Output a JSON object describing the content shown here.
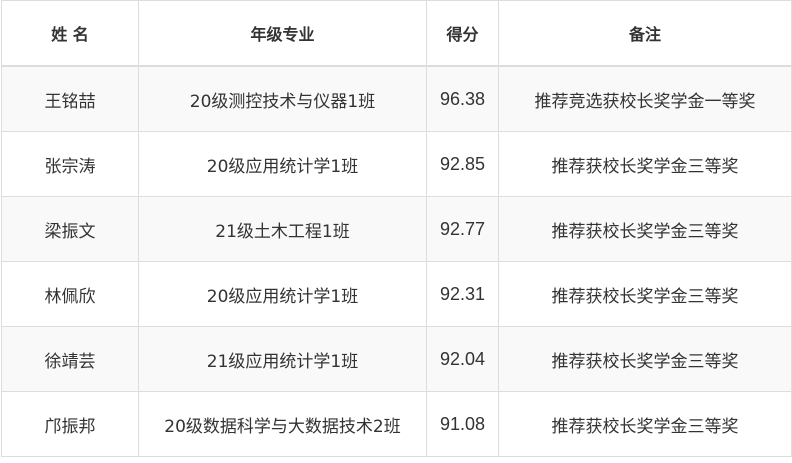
{
  "table": {
    "headers": [
      "姓 名",
      "年级专业",
      "得分",
      "备注"
    ],
    "rows": [
      {
        "name": "王铭喆",
        "major": "20级测控技术与仪器1班",
        "score": "96.38",
        "note": "推荐竞选获校长奖学金一等奖"
      },
      {
        "name": "张宗涛",
        "major": "20级应用统计学1班",
        "score": "92.85",
        "note": "推荐获校长奖学金三等奖"
      },
      {
        "name": "梁振文",
        "major": "21级土木工程1班",
        "score": "92.77",
        "note": "推荐获校长奖学金三等奖"
      },
      {
        "name": "林佩欣",
        "major": "20级应用统计学1班",
        "score": "92.31",
        "note": "推荐获校长奖学金三等奖"
      },
      {
        "name": "徐靖芸",
        "major": "21级应用统计学1班",
        "score": "92.04",
        "note": "推荐获校长奖学金三等奖"
      },
      {
        "name": "邝振邦",
        "major": "20级数据科学与大数据技术2班",
        "score": "91.08",
        "note": "推荐获校长奖学金三等奖"
      }
    ]
  }
}
